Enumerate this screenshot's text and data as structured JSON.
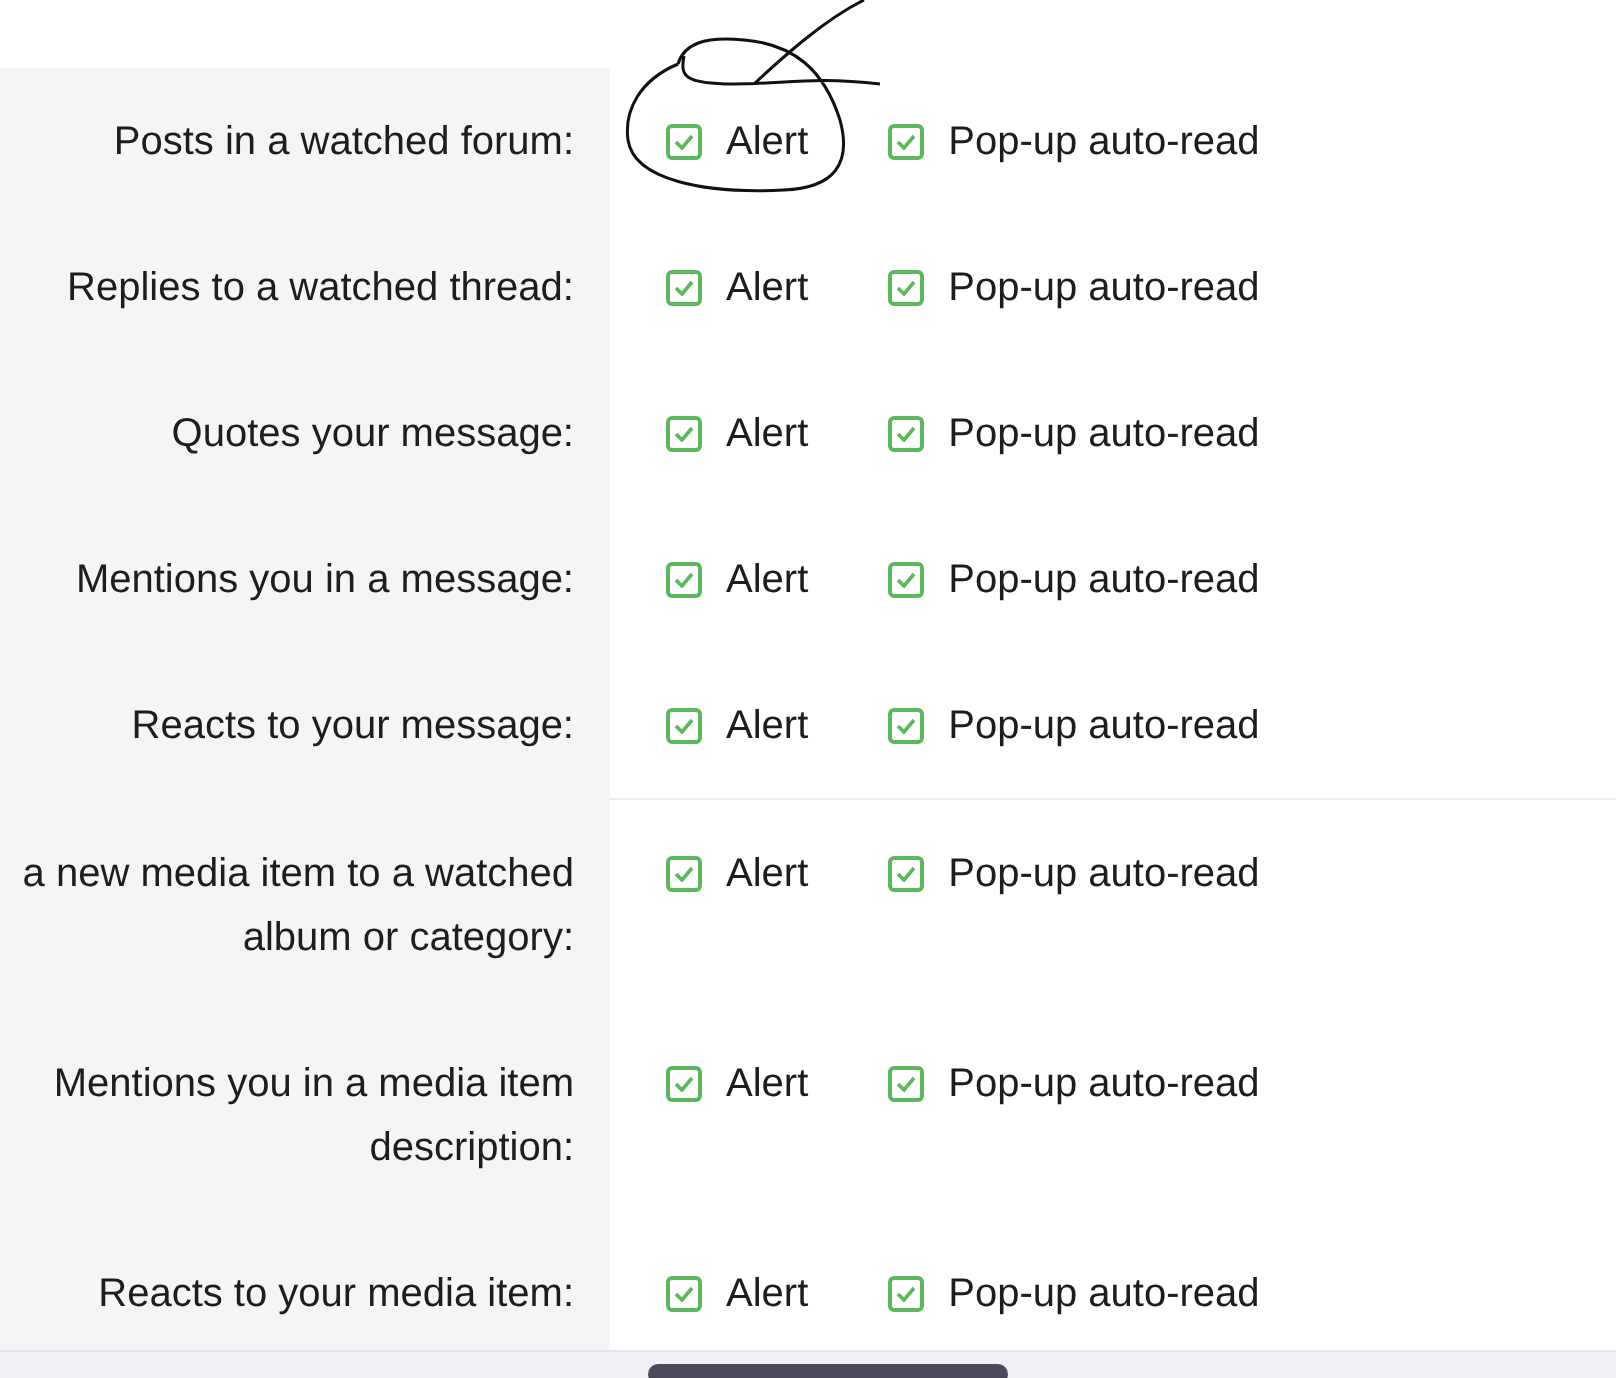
{
  "rows": [
    {
      "kind": "setting",
      "label_lines": [
        "Posts in a watched forum:"
      ],
      "options": [
        {
          "label": "Alert",
          "checked": true
        },
        {
          "label": "Pop-up auto-read",
          "checked": true
        }
      ]
    },
    {
      "kind": "setting",
      "label_lines": [
        "Replies to a watched thread:"
      ],
      "options": [
        {
          "label": "Alert",
          "checked": true
        },
        {
          "label": "Pop-up auto-read",
          "checked": true
        }
      ]
    },
    {
      "kind": "setting",
      "label_lines": [
        "Quotes your message:"
      ],
      "options": [
        {
          "label": "Alert",
          "checked": true
        },
        {
          "label": "Pop-up auto-read",
          "checked": true
        }
      ]
    },
    {
      "kind": "setting",
      "label_lines": [
        "Mentions you in a message:"
      ],
      "options": [
        {
          "label": "Alert",
          "checked": true
        },
        {
          "label": "Pop-up auto-read",
          "checked": true
        }
      ]
    },
    {
      "kind": "setting",
      "label_lines": [
        "Reacts to your message:"
      ],
      "options": [
        {
          "label": "Alert",
          "checked": true
        },
        {
          "label": "Pop-up auto-read",
          "checked": true
        }
      ]
    },
    {
      "kind": "divider"
    },
    {
      "kind": "setting",
      "label_lines": [
        "a new media item to a watched",
        "album or category:"
      ],
      "options": [
        {
          "label": "Alert",
          "checked": true
        },
        {
          "label": "Pop-up auto-read",
          "checked": true
        }
      ]
    },
    {
      "kind": "setting",
      "label_lines": [
        "Mentions you in a media item",
        "description:"
      ],
      "options": [
        {
          "label": "Alert",
          "checked": true
        },
        {
          "label": "Pop-up auto-read",
          "checked": true
        }
      ]
    },
    {
      "kind": "setting",
      "label_lines": [
        "Reacts to your media item:"
      ],
      "options": [
        {
          "label": "Alert",
          "checked": true
        },
        {
          "label": "Pop-up auto-read",
          "checked": true
        }
      ]
    }
  ]
}
